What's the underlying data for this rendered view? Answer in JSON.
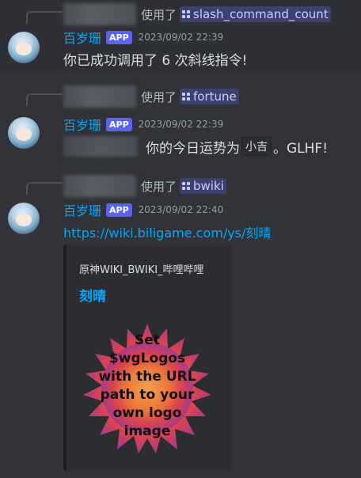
{
  "messages": [
    {
      "invoked_label": "使用了",
      "command": "slash_command_count",
      "username": "百岁珊",
      "tag": "APP",
      "timestamp": "2023/09/02 22:39",
      "content": "你已成功调用了 6 次斜线指令!"
    },
    {
      "invoked_label": "使用了",
      "command": "fortune",
      "username": "百岁珊",
      "tag": "APP",
      "timestamp": "2023/09/02 22:39",
      "content_prefix": "你的今日运势为",
      "content_code": "小吉",
      "content_suffix": "。GLHF!"
    },
    {
      "invoked_label": "使用了",
      "command": "bwiki",
      "username": "百岁珊",
      "tag": "APP",
      "timestamp": "2023/09/02 22:40",
      "link": "https://wiki.biligame.com/ys/刻晴",
      "embed": {
        "provider": "原神WIKI_BWIKI_哔哩哔哩",
        "title": "刻晴",
        "thumbnail_text": "Set\n$wgLogos\nwith the URL\npath to your\nown logo\nimage"
      }
    }
  ],
  "colors": {
    "background": "#313338",
    "username": "#00a8fc",
    "app_tag": "#5865f2",
    "link": "#00a8fc",
    "command_chip": "#3c4270"
  }
}
